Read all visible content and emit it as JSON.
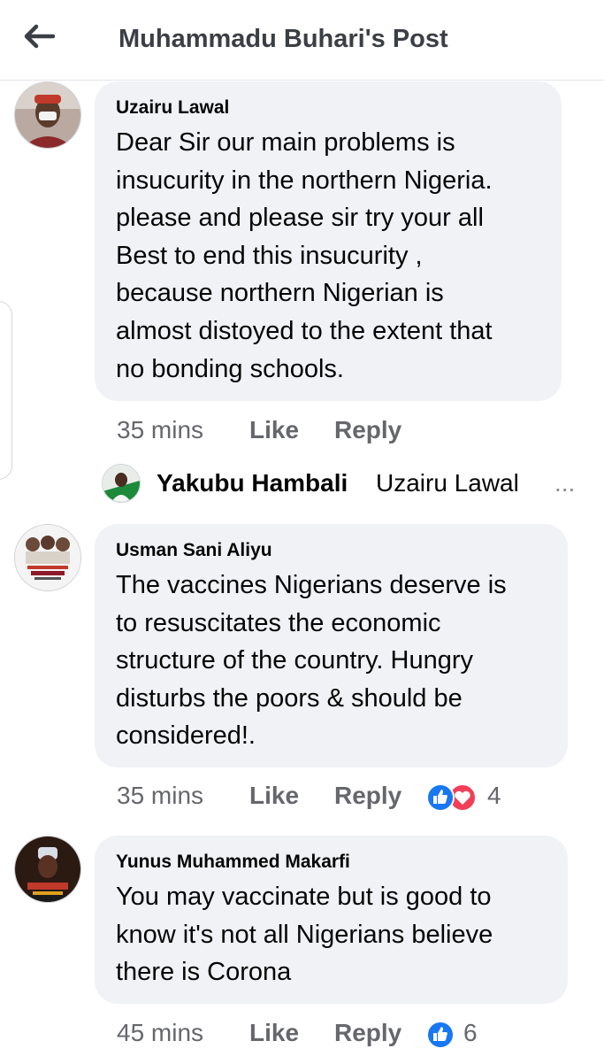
{
  "header": {
    "title": "Muhammadu Buhari's Post",
    "back_icon": "arrow-left-icon"
  },
  "comments": [
    {
      "author": "Uzairu Lawal",
      "text": "Dear Sir our main problems is\ninsucurity in the northern Nigeria.\nplease and please sir try your all\nBest to end this insucurity ,\nbecause northern Nigerian is\nalmost distoyed to the extent that\nno bonding schools.",
      "time": "35 mins",
      "like_label": "Like",
      "reply_label": "Reply"
    },
    {
      "author": "Usman Sani Aliyu",
      "text": "The vaccines Nigerians deserve is\nto resuscitates the economic\nstructure of the country. Hungry\ndisturbs the poors & should be\nconsidered!.",
      "time": "35 mins",
      "like_label": "Like",
      "reply_label": "Reply",
      "reaction_count": "4",
      "reactions": [
        "like-icon",
        "heart-icon"
      ]
    },
    {
      "author": "Yunus Muhammed Makarfi",
      "text": "You may  vaccinate but  is good to\nknow it's not all Nigerians believe\nthere is Corona",
      "time": "45 mins",
      "like_label": "Like",
      "reply_label": "Reply",
      "reaction_count": "6",
      "reactions": [
        "like-icon"
      ]
    }
  ],
  "reply_preview": {
    "author": "Yakubu Hambali",
    "snippet": "Uzairu Lawal",
    "ellipsis": "..."
  },
  "colors": {
    "bubble": "#f0f2f5",
    "meta": "#65676b",
    "like_blue": "#1877f2",
    "love_red": "#f33e58"
  }
}
